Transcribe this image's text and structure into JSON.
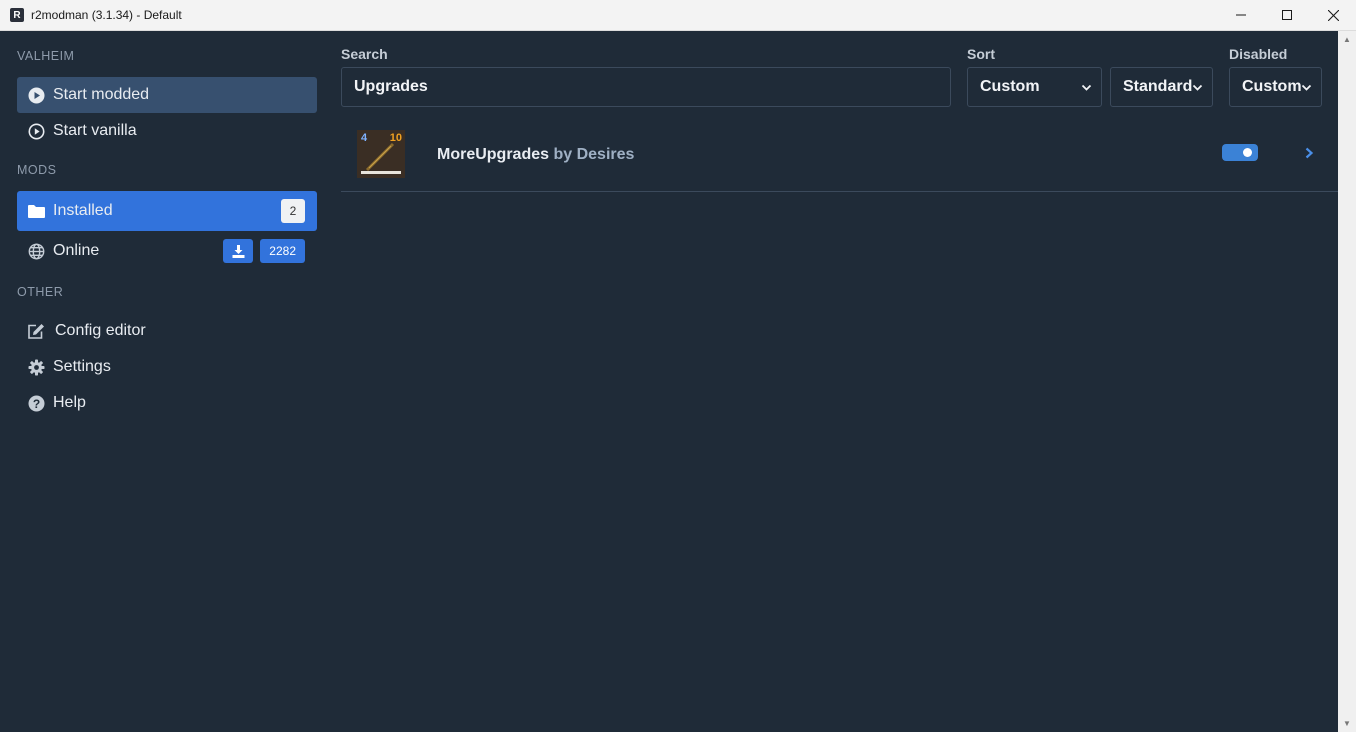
{
  "window": {
    "title": "r2modman (3.1.34) - Default",
    "app_icon_letter": "R"
  },
  "sidebar": {
    "game_label": "VALHEIM",
    "start_modded": "Start modded",
    "start_vanilla": "Start vanilla",
    "mods_label": "MODS",
    "installed": {
      "label": "Installed",
      "count": "2"
    },
    "online": {
      "label": "Online",
      "count": "2282"
    },
    "other_label": "OTHER",
    "config_editor": "Config editor",
    "settings": "Settings",
    "help": "Help"
  },
  "filters": {
    "search_label": "Search",
    "search_value": "Upgrades",
    "sort_label": "Sort",
    "sort_value": "Custom",
    "sort_direction_value": "Standard",
    "disabled_label": "Disabled",
    "disabled_value": "Custom"
  },
  "mods": [
    {
      "name": "MoreUpgrades",
      "author": "by Desires",
      "thumb_left": "4",
      "thumb_right": "10",
      "enabled": true
    }
  ],
  "colors": {
    "background": "#1f2b38",
    "accent_blue": "#3273dc",
    "active_dark": "#37506f",
    "toggle_on": "#3b82d6"
  }
}
